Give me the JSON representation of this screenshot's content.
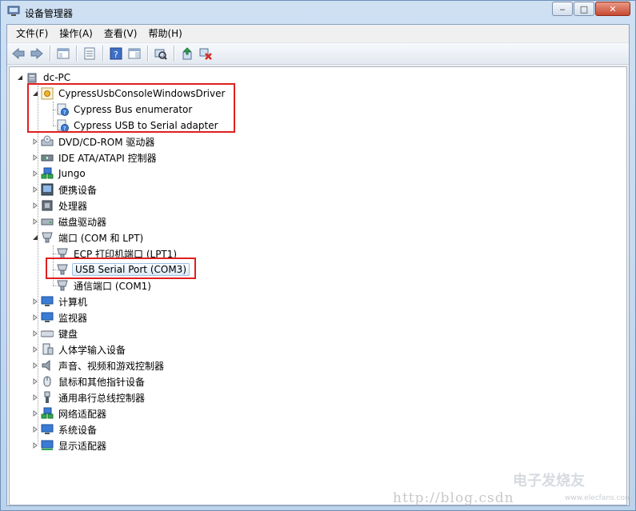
{
  "window": {
    "title": "设备管理器",
    "minimize": "‒",
    "maximize": "□",
    "close": "✕"
  },
  "menu": [
    {
      "label": "文件(F)"
    },
    {
      "label": "操作(A)"
    },
    {
      "label": "查看(V)"
    },
    {
      "label": "帮助(H)"
    }
  ],
  "tree": {
    "root": "dc-PC",
    "cypress_group": "CypressUsbConsoleWindowsDriver",
    "cypress_children": [
      "Cypress Bus enumerator",
      "Cypress USB to Serial adapter"
    ],
    "dvd": "DVD/CD-ROM 驱动器",
    "ide": "IDE ATA/ATAPI 控制器",
    "jungo": "Jungo",
    "portable": "便携设备",
    "cpu": "处理器",
    "disk": "磁盘驱动器",
    "ports": "端口 (COM 和 LPT)",
    "ports_children": [
      "ECP 打印机端口 (LPT1)",
      "USB Serial Port (COM3)",
      "通信端口 (COM1)"
    ],
    "computer": "计算机",
    "monitor": "监视器",
    "keyboard": "键盘",
    "hid": "人体学输入设备",
    "sound": "声音、视频和游戏控制器",
    "mouse": "鼠标和其他指针设备",
    "usb": "通用串行总线控制器",
    "network": "网络适配器",
    "system": "系统设备",
    "display": "显示适配器"
  },
  "watermark": {
    "text": "http://blog.csdn",
    "logo": "电子发烧友",
    "url": "www.elecfans.com"
  },
  "colors": {
    "highlight_box": "#e02020",
    "selection": "#dcebfc"
  }
}
